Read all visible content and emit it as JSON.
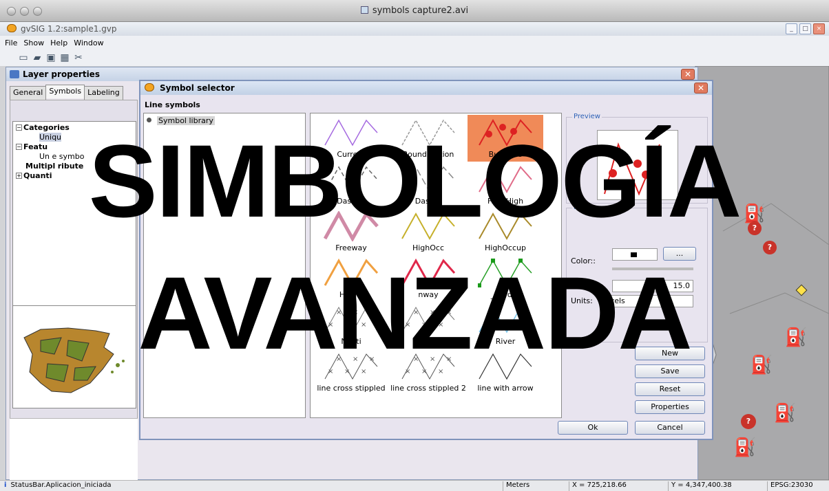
{
  "player": {
    "title": "symbols capture2.avi"
  },
  "app": {
    "title": "gvSIG 1.2:sample1.gvp",
    "menu": [
      "File",
      "Show",
      "Help",
      "Window"
    ]
  },
  "layer_props": {
    "title": "Layer properties",
    "tabs": [
      "General",
      "Symbols",
      "Labeling"
    ],
    "tree": {
      "categories": "Categories",
      "unique": "Uniqu",
      "features": "Featu",
      "unique_symbol": "Un     e symbo",
      "multiple": "Multipl",
      "multiple_tail": "ribute",
      "quantities": "Quanti"
    }
  },
  "symbol_selector": {
    "title": "Symbol selector",
    "header": "Line symbols",
    "library": "Symbol library",
    "symbols": [
      {
        "label": "Current"
      },
      {
        "label": "Bound     Nation"
      },
      {
        "label": "Bus_Line"
      },
      {
        "label": "Dashed"
      },
      {
        "label": "Dash     2"
      },
      {
        "label": "Free High"
      },
      {
        "label": "Freeway"
      },
      {
        "label": "HighOcc"
      },
      {
        "label": "HighOccup"
      },
      {
        "label": "Highw"
      },
      {
        "label": "nway"
      },
      {
        "label": "_Border"
      },
      {
        "label": "Nauti"
      },
      {
        "label": "road"
      },
      {
        "label": "River"
      },
      {
        "label": "line cross stippled"
      },
      {
        "label": "line cross stippled 2"
      },
      {
        "label": "line with arrow"
      }
    ],
    "preview_title": "Preview",
    "options_title": "ions",
    "color_label": "Color::",
    "color_btn": "...",
    "width_label": "Width:",
    "width_value": "15.0",
    "units_label": "Units:",
    "units_value": "pixels",
    "buttons": {
      "new": "New",
      "save": "Save",
      "reset": "Reset",
      "properties": "Properties",
      "ok": "Ok",
      "cancel": "Cancel"
    }
  },
  "status": {
    "message": "StatusBar.Aplicacion_iniciada",
    "units": "Meters",
    "x": "X = 725,218.66",
    "y": "Y = 4,347,400.38",
    "epsg": "EPSG:23030"
  },
  "overlay": {
    "line1": "SIMBOLOGÍA",
    "line2": "AVANZADA"
  }
}
